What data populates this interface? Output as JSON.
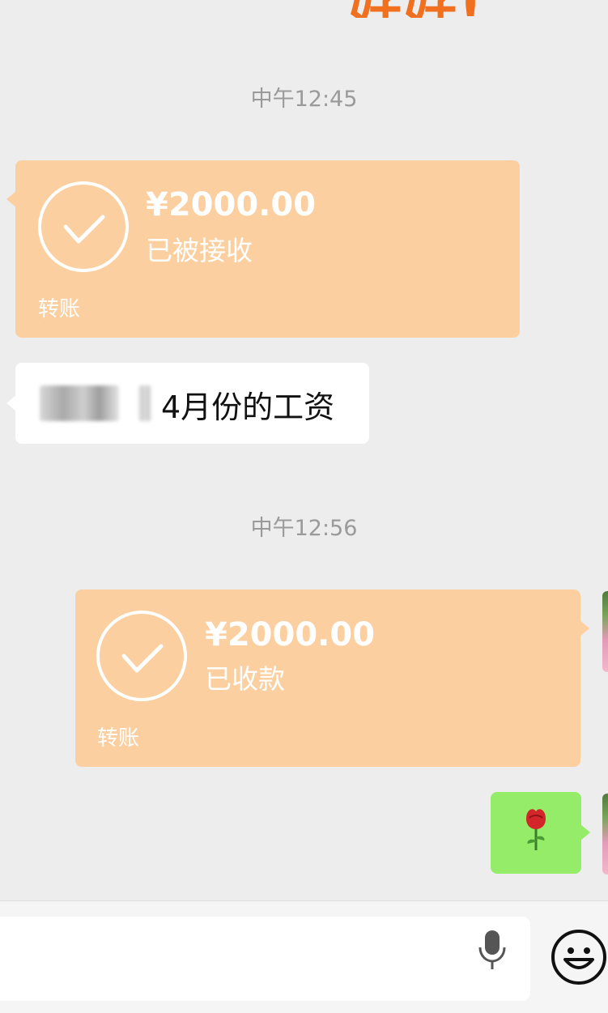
{
  "banner": {
    "text": "好好!"
  },
  "messages": [
    {
      "type": "timestamp",
      "text": "中午12:45"
    },
    {
      "type": "transfer",
      "side": "left",
      "amount": "¥2000.00",
      "status": "已被接收",
      "label": "转账"
    },
    {
      "type": "text",
      "side": "left",
      "text": "4月份的工资"
    },
    {
      "type": "timestamp",
      "text": "中午12:56"
    },
    {
      "type": "transfer",
      "side": "right",
      "amount": "¥2000.00",
      "status": "已收款",
      "label": "转账"
    },
    {
      "type": "emoji",
      "side": "right",
      "emoji": "🌹"
    }
  ],
  "colors": {
    "transfer_bubble": "#fbcf9f",
    "green_bubble": "#95ec69",
    "background": "#ededed",
    "banner": "#f0701f"
  },
  "input_bar": {
    "icons": [
      "microphone-icon",
      "emoji-face-icon"
    ]
  }
}
